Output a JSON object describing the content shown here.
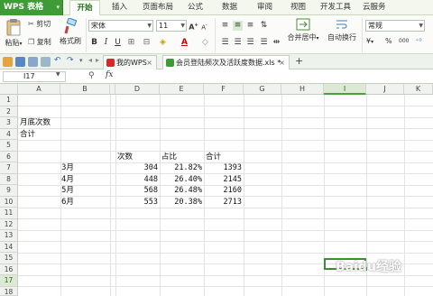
{
  "app": {
    "name": "WPS 表格"
  },
  "menu_tabs": [
    {
      "label": "开始",
      "active": true
    },
    {
      "label": "插入"
    },
    {
      "label": "页面布局"
    },
    {
      "label": "公式"
    },
    {
      "label": "数据"
    },
    {
      "label": "审阅"
    },
    {
      "label": "视图"
    },
    {
      "label": "开发工具"
    },
    {
      "label": "云服务"
    }
  ],
  "ribbon": {
    "paste": "粘贴",
    "cut": "剪切",
    "copy": "复制",
    "format_painter": "格式刷",
    "font_name": "宋体",
    "font_size": "11",
    "merge_center": "合并居中",
    "auto_wrap": "自动换行",
    "number_format": "常规",
    "currency_symbol": "¥",
    "percent_symbol": "%",
    "thousands_symbol": "000"
  },
  "doc_tabs": [
    {
      "label": "我的WPS"
    },
    {
      "label": "会员登陆频次及活跃度数据.xls *",
      "active": true
    }
  ],
  "formula_bar": {
    "cell_ref": "I17",
    "fx": "fx",
    "value": ""
  },
  "columns": [
    "A",
    "B",
    "C",
    "D",
    "E",
    "F",
    "G",
    "H",
    "I",
    "J",
    "K"
  ],
  "rows": [
    "1",
    "2",
    "3",
    "4",
    "5",
    "6",
    "7",
    "8",
    "9",
    "10",
    "11",
    "12",
    "13",
    "14",
    "15",
    "16",
    "17",
    "18"
  ],
  "selected_cell": {
    "column": "I",
    "row": "17"
  },
  "cells": {
    "a3": "月底次数",
    "a4": "合计",
    "d6": "次数",
    "e6": "占比",
    "f6": "合计",
    "b7": "3月",
    "d7": "304",
    "e7": "21.82%",
    "f7": "1393",
    "b8": "4月",
    "d8": "448",
    "e8": "26.40%",
    "f8": "2145",
    "b9": "5月",
    "d9": "568",
    "e9": "26.48%",
    "f9": "2160",
    "b10": "6月",
    "d10": "553",
    "e10": "20.38%",
    "f10": "2713"
  },
  "watermark": "Baidu经验",
  "colors": {
    "accent": "#3f9b36",
    "selected": "#3b8f31"
  }
}
